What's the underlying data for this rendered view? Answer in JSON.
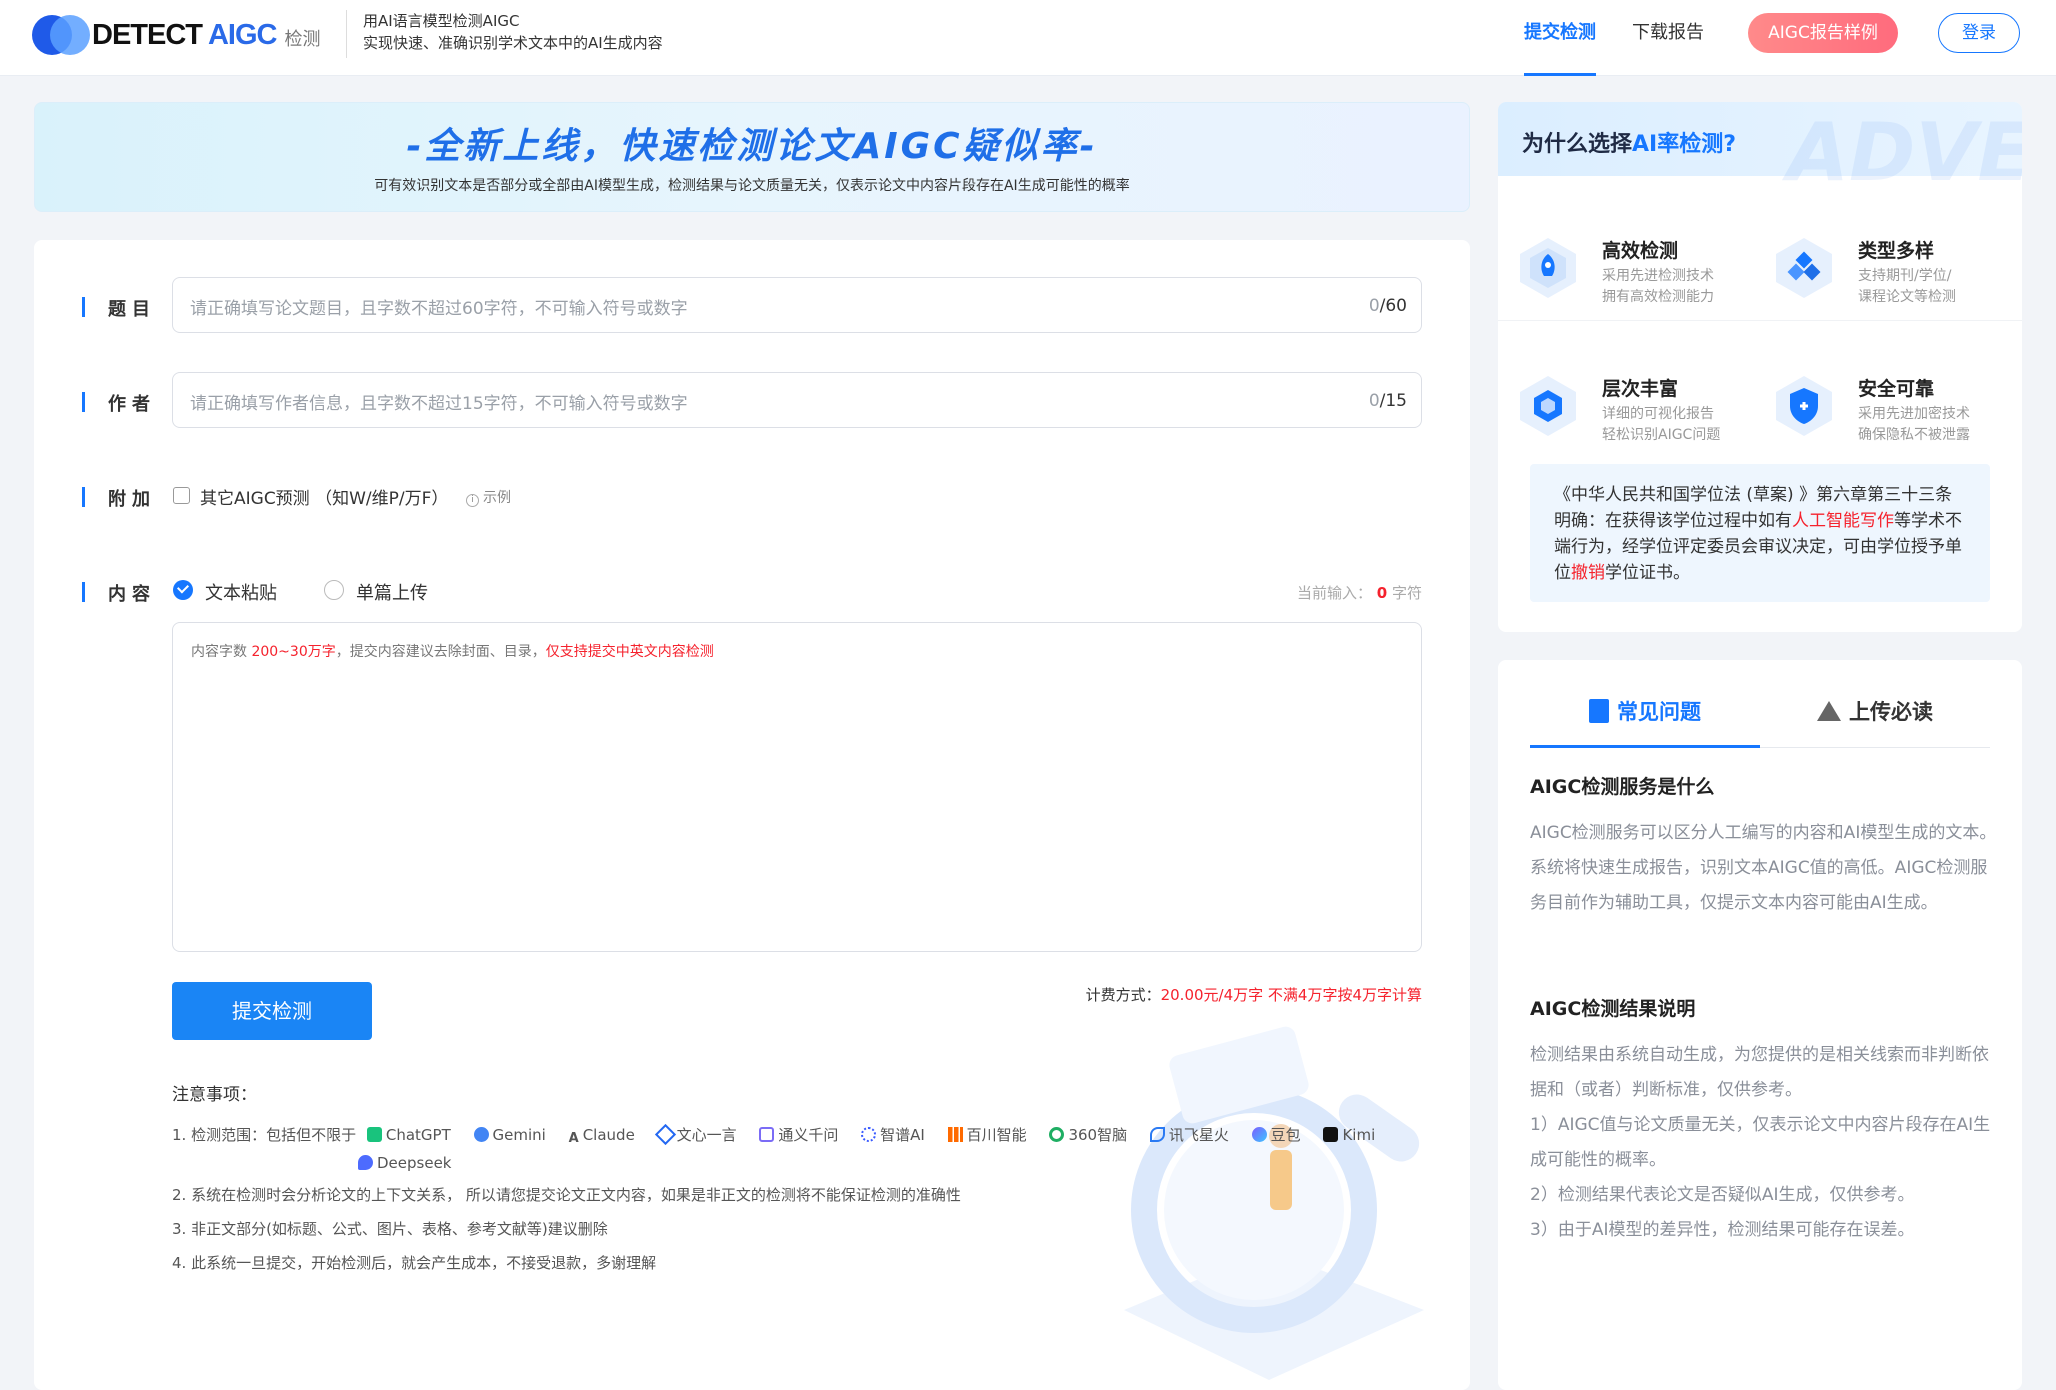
{
  "header": {
    "logo_word": "DETECT",
    "logo_brand": "AIGC",
    "logo_sub": "检测",
    "slogan_line1": "用AI语言模型检测AIGC",
    "slogan_line2": "实现快速、准确识别学术文本中的AI生成内容",
    "nav": [
      "提交检测",
      "下载报告"
    ],
    "sample_button": "AIGC报告样例",
    "login_button": "登录"
  },
  "banner": {
    "title": "-全新上线，快速检测论文AIGC疑似率-",
    "subtitle": "可有效识别文本是否部分或全部由AI模型生成，检测结果与论文质量无关，仅表示论文中内容片段存在AI生成可能性的概率"
  },
  "form": {
    "title_label": "题目",
    "title_placeholder": "请正确填写论文题目，且字数不超过60字符，不可输入符号或数字",
    "title_count": "0",
    "title_max": "/60",
    "author_label": "作者",
    "author_placeholder": "请正确填写作者信息，且字数不超过15字符，不可输入符号或数字",
    "author_count": "0",
    "author_max": "/15",
    "extra_label": "附加",
    "extra_option": "其它AIGC预测 （知W/维P/万F）",
    "extra_example": "示例",
    "content_label": "内容",
    "mode_paste": "文本粘贴",
    "mode_upload": "单篇上传",
    "current_input_label": "当前输入：",
    "current_input_value": "0",
    "current_input_unit": "字符",
    "hint_prefix": "内容字数 ",
    "hint_range": "200~30万字",
    "hint_mid": "，提交内容建议去除封面、目录，",
    "hint_red": "仅支持提交中英文内容检测",
    "submit": "提交检测",
    "pricing_label": "计费方式：",
    "pricing_value": "20.00元/4万字 不满4万字按4万字计算"
  },
  "notes": {
    "title": "注意事项：",
    "n1_prefix": "1. 检测范围：包括但不限于",
    "models": [
      "ChatGPT",
      "Gemini",
      "Claude",
      "文心一言",
      "通义千问",
      "智谱AI",
      "百川智能",
      "360智脑",
      "讯飞星火",
      "豆包",
      "Kimi",
      "Deepseek"
    ],
    "n2": "2. 系统在检测时会分析论文的上下文关系， 所以请您提交论文正文内容，如果是非正文的检测将不能保证检测的准确性",
    "n3": "3. 非正文部分(如标题、公式、图片、表格、参考文献等)建议删除",
    "n4": "4. 此系统一旦提交，开始检测后，就会产生成本，不接受退款，多谢理解"
  },
  "why": {
    "title_prefix": "为什么选择",
    "title_highlight": "AI率检测?",
    "ghost": "ADVE",
    "features": [
      {
        "title": "高效检测",
        "line1": "采用先进检测技术",
        "line2": "拥有高效检测能力"
      },
      {
        "title": "类型多样",
        "line1": "支持期刊/学位/",
        "line2": "课程论文等检测"
      },
      {
        "title": "层次丰富",
        "line1": "详细的可视化报告",
        "line2": "轻松识别AIGC问题"
      },
      {
        "title": "安全可靠",
        "line1": "采用先进加密技术",
        "line2": "确保隐私不被泄露"
      }
    ],
    "law_a": "《中华人民共和国学位法 (草案) 》第六章第三十三条明确：在获得该学位过程中如有",
    "law_red1": "人工智能写作",
    "law_b": "等学术不端行为，经学位评定委员会审议决定，可由学位授予单位",
    "law_red2": "撤销",
    "law_c": "学位证书。"
  },
  "faq": {
    "tabs": [
      "常见问题",
      "上传必读"
    ],
    "q1": "AIGC检测服务是什么",
    "a1": "AIGC检测服务可以区分人工编写的内容和AI模型生成的文本。 系统将快速生成报告，识别文本AIGC值的高低。AIGC检测服务目前作为辅助工具，仅提示文本内容可能由AI生成。",
    "q2": "AIGC检测结果说明",
    "a2": "检测结果由系统自动生成，为您提供的是相关线索而非判断依据和（或者）判断标准，仅供参考。",
    "a2_1": "1）AIGC值与论文质量无关，仅表示论文中内容片段存在AI生成可能性的概率。",
    "a2_2": "2）检测结果代表论文是否疑似AI生成，仅供参考。",
    "a2_3": "3）由于AI模型的差异性，检测结果可能存在误差。"
  },
  "colors": {
    "accent": "#1677ff",
    "danger": "#f5222d"
  }
}
